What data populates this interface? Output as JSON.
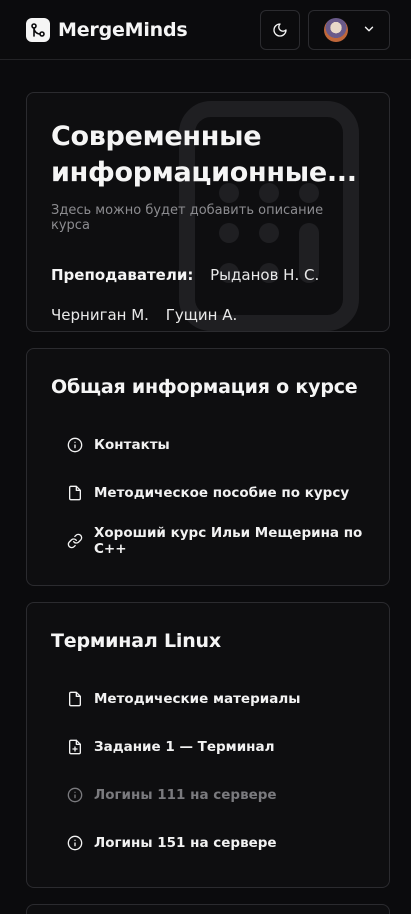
{
  "app": {
    "name": "MergeMinds"
  },
  "icons": {
    "logo": "git-merge-icon",
    "theme": "moon-icon",
    "dropdown": "chevron-down-icon"
  },
  "course": {
    "title": "Современные информационные...",
    "description": "Здесь можно будет добавить описание курса",
    "teachers_label": "Преподаватели:",
    "teachers": [
      "Рыданов Н. С.",
      "Черниган М.",
      "Гущин А."
    ]
  },
  "sections": [
    {
      "title": "Общая информация о курсе",
      "items": [
        {
          "icon": "info-icon",
          "label": "Контакты"
        },
        {
          "icon": "file-icon",
          "label": "Методическое пособие по курсу"
        },
        {
          "icon": "link-icon",
          "label": "Хороший курс Ильи Мещерина по C++"
        }
      ]
    },
    {
      "title": "Терминал Linux",
      "items": [
        {
          "icon": "file-icon",
          "label": "Методические материалы"
        },
        {
          "icon": "file-plus-icon",
          "label": "Задание 1 — Терминал"
        },
        {
          "icon": "info-icon",
          "label": "Логины 111 на сервере",
          "muted": true
        },
        {
          "icon": "info-icon",
          "label": "Логины 151 на сервере"
        }
      ]
    }
  ],
  "colors": {
    "background": "#0b0b0d",
    "card_border": "#2b2b2f",
    "text": "#f5f5f5",
    "muted_text": "#8c8c90"
  }
}
